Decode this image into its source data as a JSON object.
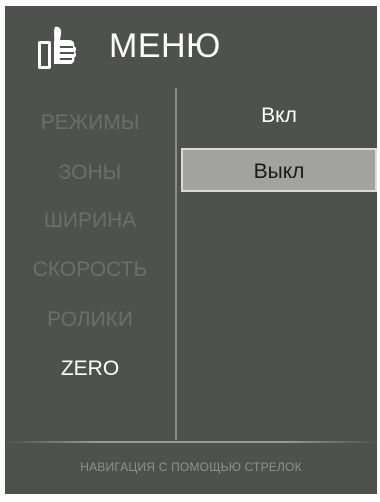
{
  "header": {
    "title": "МЕНЮ",
    "icon": "thumbs-up-icon"
  },
  "left_menu": {
    "items": [
      {
        "label": "РЕЖИМЫ",
        "active": false
      },
      {
        "label": "ЗОНЫ",
        "active": false
      },
      {
        "label": "ШИРИНА",
        "active": false
      },
      {
        "label": "СКОРОСТЬ",
        "active": false
      },
      {
        "label": "РОЛИКИ",
        "active": false
      },
      {
        "label": "ZERO",
        "active": true
      }
    ]
  },
  "right_menu": {
    "options": [
      {
        "label": "Вкл",
        "selected": false
      },
      {
        "label": "Выкл",
        "selected": true
      }
    ]
  },
  "footer": {
    "hint": "НАВИГАЦИЯ С ПОМОЩЬЮ СТРЕЛОК"
  },
  "colors": {
    "background": "#4f514e",
    "inactive_text": "#6c6e6a",
    "active_text": "#ffffff",
    "selection_bg": "#a2a3a0"
  }
}
